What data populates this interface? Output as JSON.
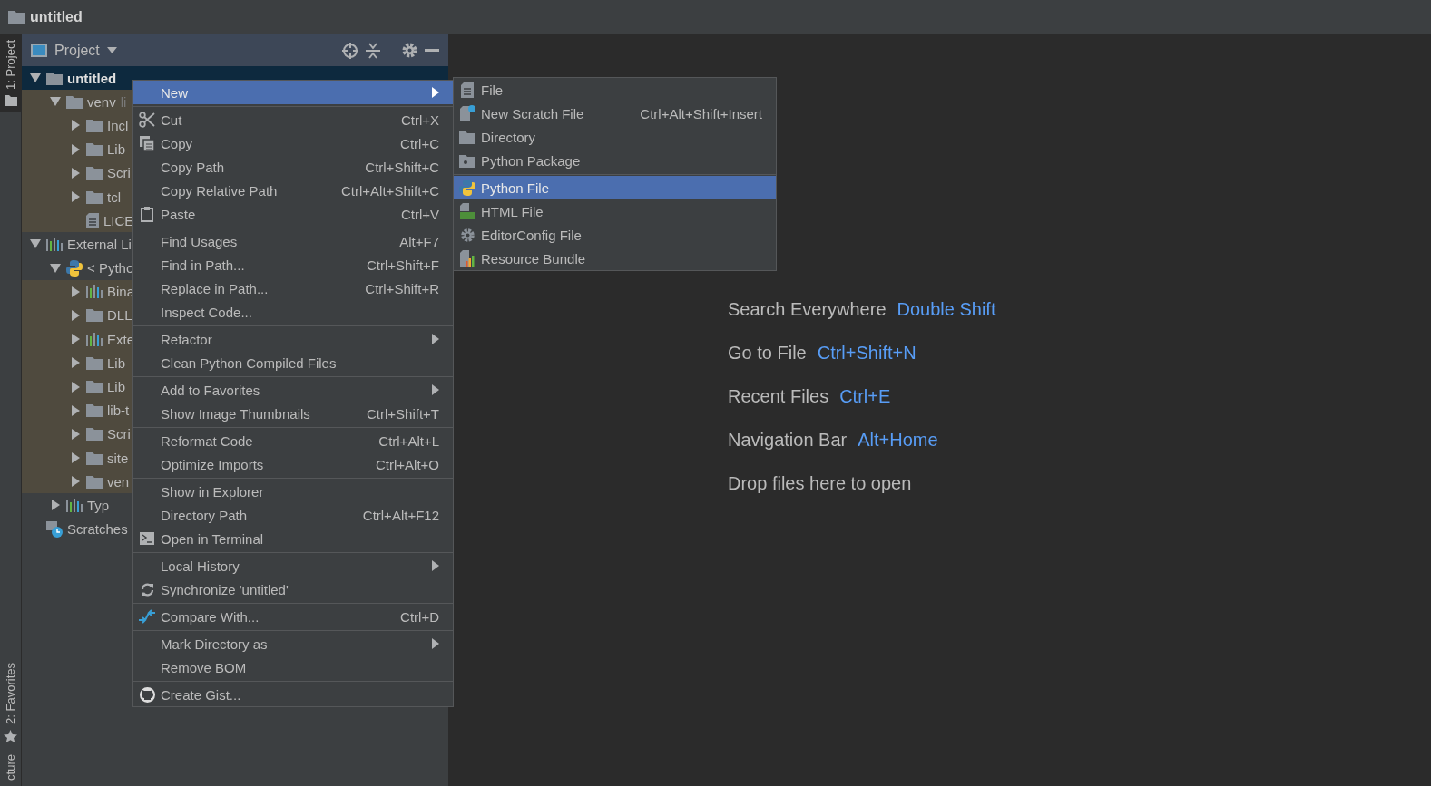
{
  "window": {
    "title": "untitled"
  },
  "side_tabs": [
    {
      "label": "1: Project",
      "selected": true,
      "kind": "project"
    },
    {
      "label": "2: Favorites",
      "selected": false,
      "kind": "favorites"
    },
    {
      "label": "cture",
      "selected": false,
      "kind": "plain"
    }
  ],
  "project_panel": {
    "title": "Project",
    "tree": [
      {
        "label": "untitled",
        "kind": "folder",
        "expanded": true,
        "selected": true,
        "children": [
          {
            "label": "venv",
            "hint": "li",
            "kind": "folder",
            "expanded": true,
            "selected": false,
            "tinted": true,
            "children": [
              {
                "label": "Incl",
                "kind": "folder",
                "expanded": false,
                "selected": false,
                "tinted": true
              },
              {
                "label": "Lib",
                "kind": "folder",
                "expanded": false,
                "selected": false,
                "tinted": true
              },
              {
                "label": "Scri",
                "kind": "folder",
                "expanded": false,
                "selected": false,
                "tinted": true
              },
              {
                "label": "tcl",
                "kind": "folder",
                "expanded": false,
                "selected": false,
                "tinted": true
              },
              {
                "label": "LICE",
                "kind": "file",
                "selected": false,
                "tinted": true
              }
            ]
          }
        ]
      },
      {
        "label": "External Li",
        "kind": "library",
        "expanded": true,
        "selected": false,
        "tinted": false,
        "children": [
          {
            "label": "< Pytho",
            "kind": "python",
            "expanded": true,
            "selected": false,
            "tinted": false,
            "children": [
              {
                "label": "Bina",
                "kind": "library",
                "expanded": false,
                "selected": false,
                "tinted": true
              },
              {
                "label": "DLL",
                "kind": "folder",
                "expanded": false,
                "selected": false,
                "tinted": true
              },
              {
                "label": "Exte",
                "kind": "library",
                "expanded": false,
                "selected": false,
                "tinted": true
              },
              {
                "label": "Lib",
                "kind": "folder",
                "expanded": false,
                "selected": false,
                "tinted": true
              },
              {
                "label": "Lib",
                "kind": "folder",
                "expanded": false,
                "selected": false,
                "tinted": true
              },
              {
                "label": "lib-t",
                "kind": "folder",
                "expanded": false,
                "selected": false,
                "tinted": true
              },
              {
                "label": "Scri",
                "kind": "folder",
                "expanded": false,
                "selected": false,
                "tinted": true
              },
              {
                "label": "site",
                "kind": "folder",
                "expanded": false,
                "selected": false,
                "tinted": true
              },
              {
                "label": "ven",
                "kind": "folder",
                "expanded": false,
                "selected": false,
                "tinted": true
              }
            ]
          },
          {
            "label": "Typ",
            "kind": "library",
            "expanded": false,
            "selected": false,
            "tinted": false
          }
        ]
      },
      {
        "label": "Scratches",
        "kind": "scratches",
        "selected": false,
        "tinted": false
      }
    ]
  },
  "context_menu": {
    "groups": [
      [
        {
          "label": "New",
          "kind": "plain",
          "submenu": true,
          "selected": true
        }
      ],
      [
        {
          "label": "Cut",
          "kind": "cut",
          "shortcut": "Ctrl+X",
          "submenu": false,
          "selected": false
        },
        {
          "label": "Copy",
          "kind": "copy",
          "shortcut": "Ctrl+C",
          "submenu": false,
          "selected": false
        },
        {
          "label": "Copy Path",
          "kind": "plain",
          "shortcut": "Ctrl+Shift+C",
          "submenu": false,
          "selected": false
        },
        {
          "label": "Copy Relative Path",
          "kind": "plain",
          "shortcut": "Ctrl+Alt+Shift+C",
          "submenu": false,
          "selected": false
        },
        {
          "label": "Paste",
          "kind": "paste",
          "shortcut": "Ctrl+V",
          "submenu": false,
          "selected": false
        }
      ],
      [
        {
          "label": "Find Usages",
          "kind": "plain",
          "shortcut": "Alt+F7",
          "submenu": false,
          "selected": false
        },
        {
          "label": "Find in Path...",
          "kind": "plain",
          "shortcut": "Ctrl+Shift+F",
          "submenu": false,
          "selected": false
        },
        {
          "label": "Replace in Path...",
          "kind": "plain",
          "shortcut": "Ctrl+Shift+R",
          "submenu": false,
          "selected": false
        },
        {
          "label": "Inspect Code...",
          "kind": "plain",
          "submenu": false,
          "selected": false
        }
      ],
      [
        {
          "label": "Refactor",
          "kind": "plain",
          "submenu": true,
          "selected": false
        },
        {
          "label": "Clean Python Compiled Files",
          "kind": "plain",
          "submenu": false,
          "selected": false
        }
      ],
      [
        {
          "label": "Add to Favorites",
          "kind": "plain",
          "submenu": true,
          "selected": false
        },
        {
          "label": "Show Image Thumbnails",
          "kind": "plain",
          "shortcut": "Ctrl+Shift+T",
          "submenu": false,
          "selected": false
        }
      ],
      [
        {
          "label": "Reformat Code",
          "kind": "plain",
          "shortcut": "Ctrl+Alt+L",
          "submenu": false,
          "selected": false
        },
        {
          "label": "Optimize Imports",
          "kind": "plain",
          "shortcut": "Ctrl+Alt+O",
          "submenu": false,
          "selected": false
        }
      ],
      [
        {
          "label": "Show in Explorer",
          "kind": "plain",
          "submenu": false,
          "selected": false
        },
        {
          "label": "Directory Path",
          "kind": "plain",
          "shortcut": "Ctrl+Alt+F12",
          "submenu": false,
          "selected": false
        },
        {
          "label": "Open in Terminal",
          "kind": "terminal",
          "submenu": false,
          "selected": false
        }
      ],
      [
        {
          "label": "Local History",
          "kind": "plain",
          "submenu": true,
          "selected": false
        },
        {
          "label": "Synchronize 'untitled'",
          "kind": "sync",
          "submenu": false,
          "selected": false
        }
      ],
      [
        {
          "label": "Compare With...",
          "kind": "compare",
          "shortcut": "Ctrl+D",
          "submenu": false,
          "selected": false
        }
      ],
      [
        {
          "label": "Mark Directory as",
          "kind": "plain",
          "submenu": true,
          "selected": false
        },
        {
          "label": "Remove BOM",
          "kind": "plain",
          "submenu": false,
          "selected": false
        }
      ],
      [
        {
          "label": "Create Gist...",
          "kind": "github",
          "submenu": false,
          "selected": false
        }
      ]
    ]
  },
  "new_submenu": {
    "groups": [
      [
        {
          "label": "File",
          "kind": "file",
          "selected": false
        },
        {
          "label": "New Scratch File",
          "kind": "scratch",
          "shortcut": "Ctrl+Alt+Shift+Insert",
          "selected": false
        },
        {
          "label": "Directory",
          "kind": "folder",
          "selected": false
        },
        {
          "label": "Python Package",
          "kind": "package",
          "selected": false
        }
      ],
      [
        {
          "label": "Python File",
          "kind": "python",
          "selected": true
        },
        {
          "label": "HTML File",
          "kind": "html",
          "selected": false
        },
        {
          "label": "EditorConfig File",
          "kind": "gear",
          "selected": false
        },
        {
          "label": "Resource Bundle",
          "kind": "bundle",
          "selected": false
        }
      ]
    ]
  },
  "editor_hints": [
    {
      "label": "Search Everywhere",
      "shortcut": "Double Shift"
    },
    {
      "label": "Go to File",
      "shortcut": "Ctrl+Shift+N"
    },
    {
      "label": "Recent Files",
      "shortcut": "Ctrl+E"
    },
    {
      "label": "Navigation Bar",
      "shortcut": "Alt+Home"
    },
    {
      "label": "Drop files here to open"
    }
  ]
}
